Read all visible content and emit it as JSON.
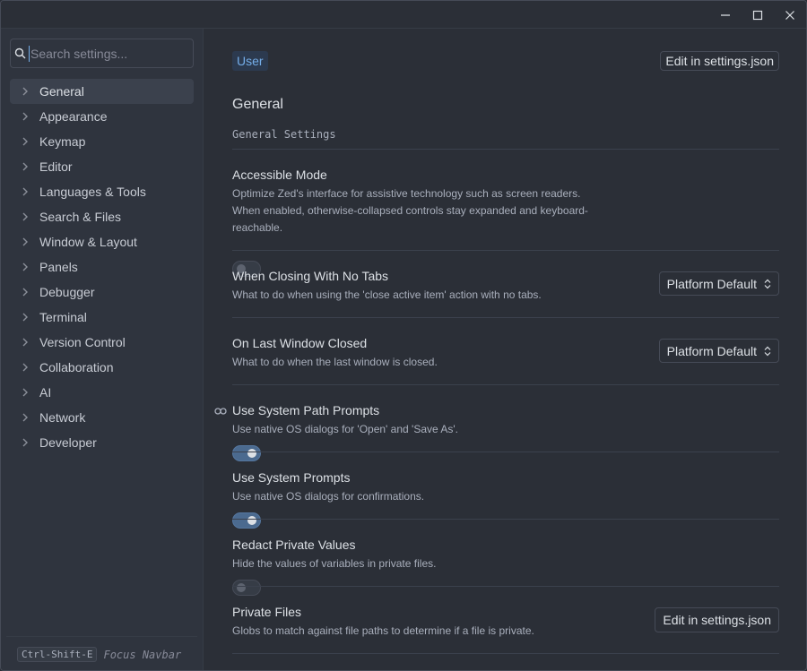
{
  "window": {
    "controls": [
      {
        "name": "minimize-icon"
      },
      {
        "name": "maximize-icon"
      },
      {
        "name": "close-icon"
      }
    ]
  },
  "sidebar": {
    "search": {
      "placeholder": "Search settings..."
    },
    "items": [
      {
        "label": "General",
        "active": true
      },
      {
        "label": "Appearance"
      },
      {
        "label": "Keymap"
      },
      {
        "label": "Editor"
      },
      {
        "label": "Languages & Tools"
      },
      {
        "label": "Search & Files"
      },
      {
        "label": "Window & Layout"
      },
      {
        "label": "Panels"
      },
      {
        "label": "Debugger"
      },
      {
        "label": "Terminal"
      },
      {
        "label": "Version Control"
      },
      {
        "label": "Collaboration"
      },
      {
        "label": "AI"
      },
      {
        "label": "Network"
      },
      {
        "label": "Developer"
      }
    ],
    "footer": {
      "shortcut": "Ctrl-Shift-E",
      "label": "Focus Navbar"
    }
  },
  "main": {
    "scope_tab": "User",
    "edit_json_label": "Edit in settings.json",
    "section_title": "General",
    "section_subtitle": "General Settings",
    "settings": [
      {
        "title": "Accessible Mode",
        "description": "Optimize Zed's interface for assistive technology such as screen readers. When enabled, otherwise-collapsed controls stay expanded and keyboard-reachable.",
        "control": "toggle",
        "value": false
      },
      {
        "title": "When Closing With No Tabs",
        "description": "What to do when using the 'close active item' action with no tabs.",
        "control": "dropdown",
        "value": "Platform Default"
      },
      {
        "title": "On Last Window Closed",
        "description": "What to do when the last window is closed.",
        "control": "dropdown",
        "value": "Platform Default"
      },
      {
        "title": "Use System Path Prompts",
        "description": "Use native OS dialogs for 'Open' and 'Save As'.",
        "control": "toggle",
        "value": true,
        "linked": true
      },
      {
        "title": "Use System Prompts",
        "description": "Use native OS dialogs for confirmations.",
        "control": "toggle",
        "value": true
      },
      {
        "title": "Redact Private Values",
        "description": "Hide the values of variables in private files.",
        "control": "toggle",
        "value": false
      },
      {
        "title": "Private Files",
        "description": "Globs to match against file paths to determine if a file is private.",
        "control": "button",
        "value": "Edit in settings.json"
      }
    ]
  },
  "colors": {
    "accent": "#74ade8",
    "toggle_on": "#4b6a8f",
    "background": "#2b2f37",
    "sidebar": "#2f343e"
  }
}
